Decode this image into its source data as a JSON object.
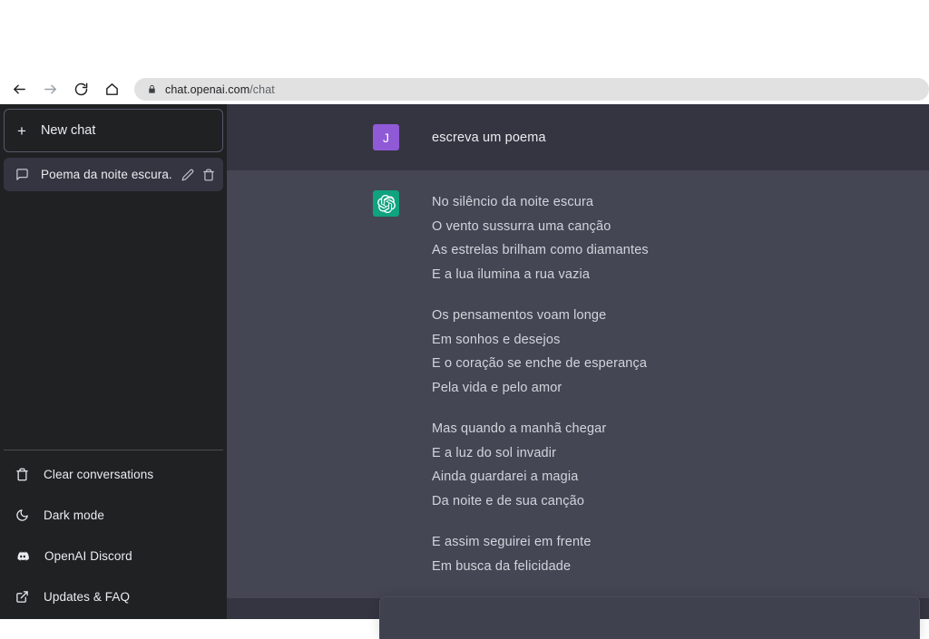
{
  "browser": {
    "back_icon": "arrow-left-icon",
    "forward_icon": "arrow-right-icon",
    "reload_icon": "reload-icon",
    "home_icon": "home-icon",
    "lock_icon": "lock-icon",
    "url_host": "chat.openai.com",
    "url_path": "/chat",
    "url_full": "chat.openai.com/chat"
  },
  "sidebar": {
    "new_chat_label": "New chat",
    "new_chat_plus": "+",
    "conversations": [
      {
        "title": "Poema da noite escura.",
        "icon": "message-icon",
        "edit_icon": "pencil-icon",
        "delete_icon": "trash-icon",
        "active": true
      }
    ],
    "footer_items": [
      {
        "label": "Clear conversations",
        "icon": "trash-icon"
      },
      {
        "label": "Dark mode",
        "icon": "moon-icon"
      },
      {
        "label": "OpenAI Discord",
        "icon": "discord-icon"
      },
      {
        "label": "Updates & FAQ",
        "icon": "external-link-icon"
      }
    ]
  },
  "chat": {
    "user_message": {
      "avatar_initial": "J",
      "avatar_color": "#9059d6",
      "text": "escreva um poema"
    },
    "assistant_message": {
      "avatar_icon": "openai-logo-icon",
      "avatar_color": "#10a37f",
      "stanzas": [
        [
          "No silêncio da noite escura",
          "O vento sussurra uma canção",
          "As estrelas brilham como diamantes",
          "E a lua ilumina a rua vazia"
        ],
        [
          "Os pensamentos voam longe",
          "Em sonhos e desejos",
          "E o coração se enche de esperança",
          "Pela vida e pelo amor"
        ],
        [
          "Mas quando a manhã chegar",
          "E a luz do sol invadir",
          "Ainda guardarei a magia",
          "Da noite e de sua canção"
        ],
        [
          "E assim seguirei em frente",
          "Em busca da felicidade"
        ]
      ]
    }
  },
  "composer": {
    "value": "",
    "placeholder": ""
  },
  "colors": {
    "sidebar_bg": "#202123",
    "user_msg_bg": "#343541",
    "assistant_msg_bg": "#444654",
    "accent_green": "#10a37f",
    "accent_purple": "#9059d6"
  }
}
